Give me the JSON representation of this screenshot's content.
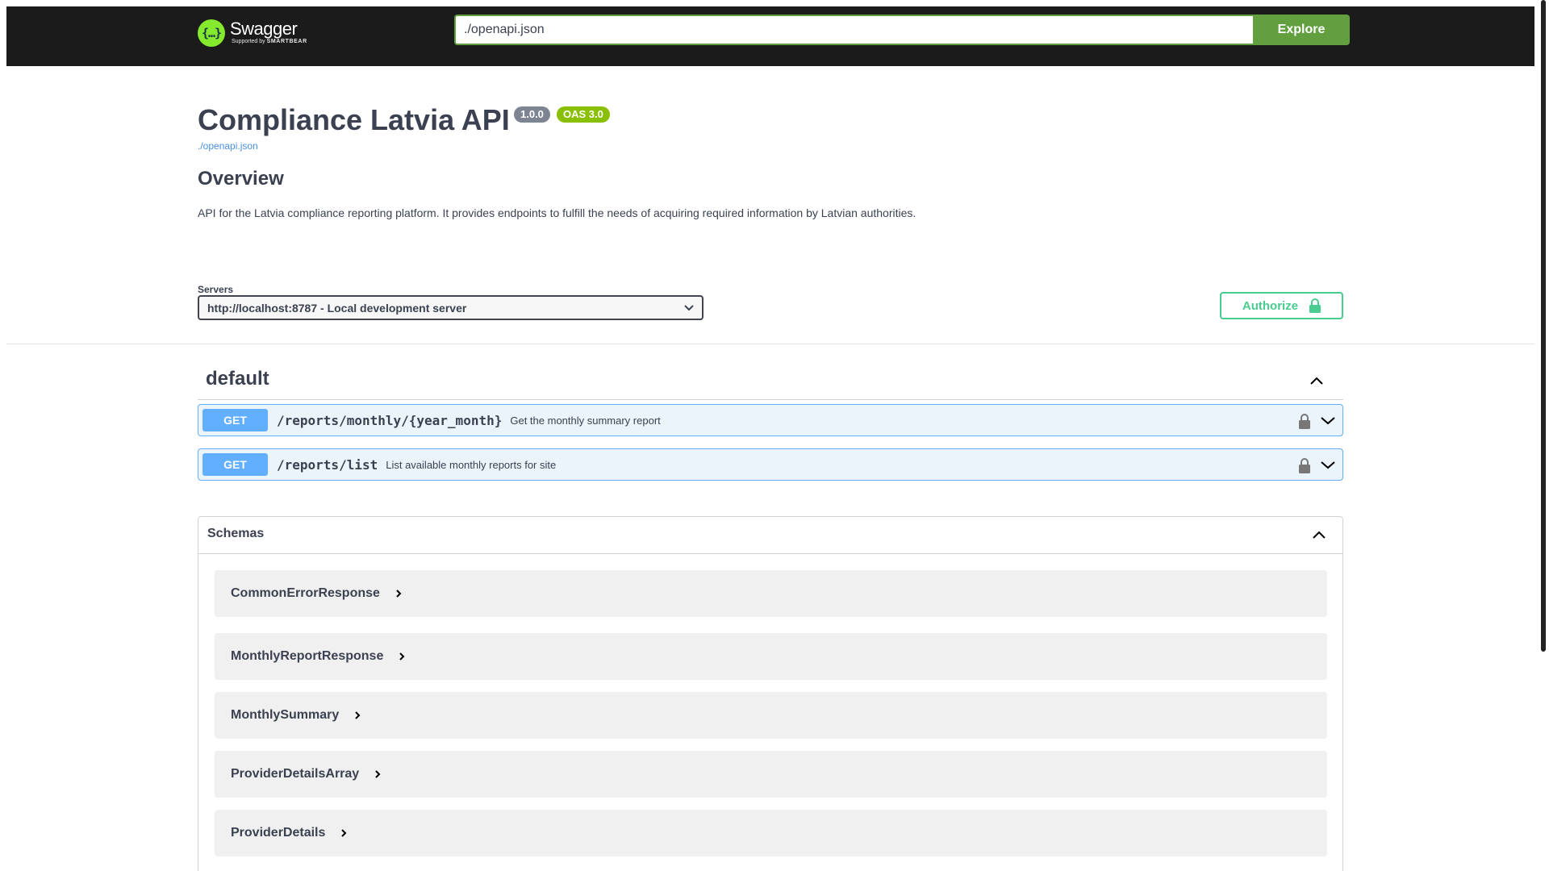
{
  "topbar": {
    "logo_name": "Swagger",
    "logo_sub_prefix": "Supported by",
    "logo_sub_brand": "SMARTBEAR",
    "url_value": "./openapi.json",
    "explore_label": "Explore"
  },
  "info": {
    "title": "Compliance Latvia API",
    "version": "1.0.0",
    "oas": "OAS 3.0",
    "spec_link": "./openapi.json",
    "overview_heading": "Overview",
    "description": "API for the Latvia compliance reporting platform. It provides endpoints to fulfill the needs of acquiring required information by Latvian authorities."
  },
  "servers": {
    "label": "Servers",
    "selected": "http://localhost:8787 - Local development server"
  },
  "authorize_label": "Authorize",
  "tag": {
    "name": "default",
    "operations": [
      {
        "method": "GET",
        "path": "/reports/monthly/{year_month}",
        "summary": "Get the monthly summary report"
      },
      {
        "method": "GET",
        "path": "/reports/list",
        "summary": "List available monthly reports for site"
      }
    ]
  },
  "schemas": {
    "title": "Schemas",
    "models": [
      "CommonErrorResponse",
      "MonthlyReportResponse",
      "MonthlySummary",
      "ProviderDetailsArray",
      "ProviderDetails"
    ]
  },
  "colors": {
    "topbar_bg": "#1b1b1b",
    "explore_green": "#62a03f",
    "get_blue": "#61affe",
    "get_bg": "#ebf3fb",
    "authorize_green": "#49cc90",
    "version_badge": "#7d8492",
    "oas_badge": "#89bf04"
  },
  "icons": [
    "swagger-logo-icon",
    "chevron-down-icon",
    "lock-icon",
    "chevron-up-icon",
    "chevron-right-icon"
  ]
}
